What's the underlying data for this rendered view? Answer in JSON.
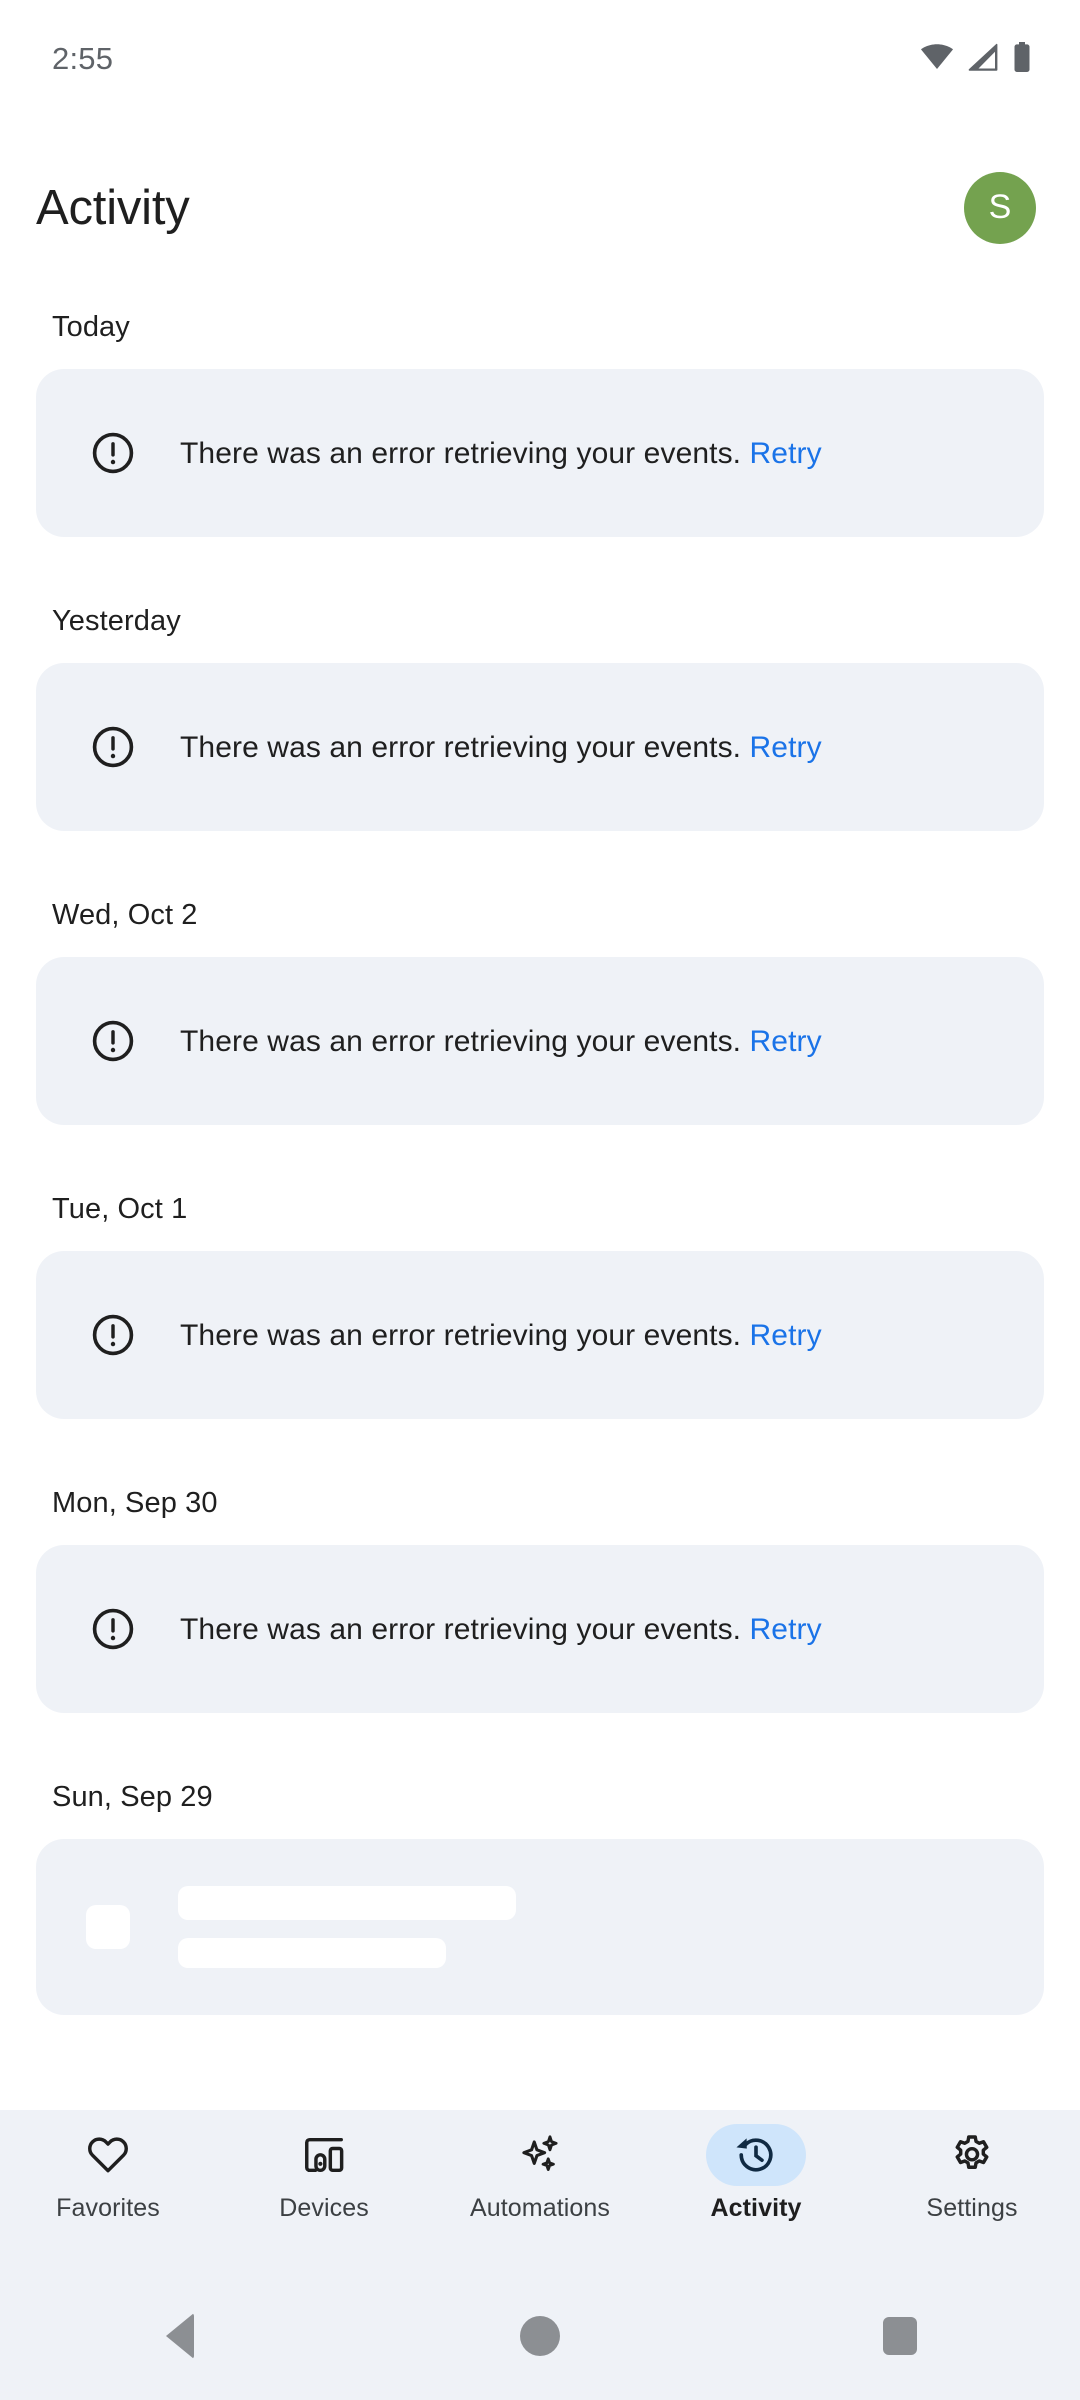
{
  "status_bar": {
    "time": "2:55",
    "icons": [
      "wifi-icon",
      "cellular-signal-icon",
      "battery-icon"
    ]
  },
  "header": {
    "title": "Activity",
    "avatar_initial": "S",
    "avatar_color": "#74A24F"
  },
  "colors": {
    "card_background": "#EFF2F7",
    "link": "#1A73E8",
    "active_pill": "#CFE5FB",
    "page_background": "#FFFFFF"
  },
  "activity_groups": [
    {
      "date_label": "Today",
      "card": {
        "type": "error",
        "icon": "error-circle-icon",
        "message": "There was an error retrieving your events.",
        "action_label": "Retry"
      }
    },
    {
      "date_label": "Yesterday",
      "card": {
        "type": "error",
        "icon": "error-circle-icon",
        "message": "There was an error retrieving your events.",
        "action_label": "Retry"
      }
    },
    {
      "date_label": "Wed, Oct 2",
      "card": {
        "type": "error",
        "icon": "error-circle-icon",
        "message": "There was an error retrieving your events.",
        "action_label": "Retry"
      }
    },
    {
      "date_label": "Tue, Oct 1",
      "card": {
        "type": "error",
        "icon": "error-circle-icon",
        "message": "There was an error retrieving your events.",
        "action_label": "Retry"
      }
    },
    {
      "date_label": "Mon, Sep 30",
      "card": {
        "type": "error",
        "icon": "error-circle-icon",
        "message": "There was an error retrieving your events.",
        "action_label": "Retry"
      }
    },
    {
      "date_label": "Sun, Sep 29",
      "card": {
        "type": "skeleton"
      }
    }
  ],
  "bottom_nav": {
    "items": [
      {
        "label": "Favorites",
        "icon": "heart-icon",
        "active": false
      },
      {
        "label": "Devices",
        "icon": "devices-icon",
        "active": false
      },
      {
        "label": "Automations",
        "icon": "sparkles-icon",
        "active": false
      },
      {
        "label": "Activity",
        "icon": "history-icon",
        "active": true
      },
      {
        "label": "Settings",
        "icon": "gear-icon",
        "active": false
      }
    ]
  },
  "system_nav": {
    "buttons": [
      "back-button",
      "home-button",
      "recents-button"
    ]
  }
}
